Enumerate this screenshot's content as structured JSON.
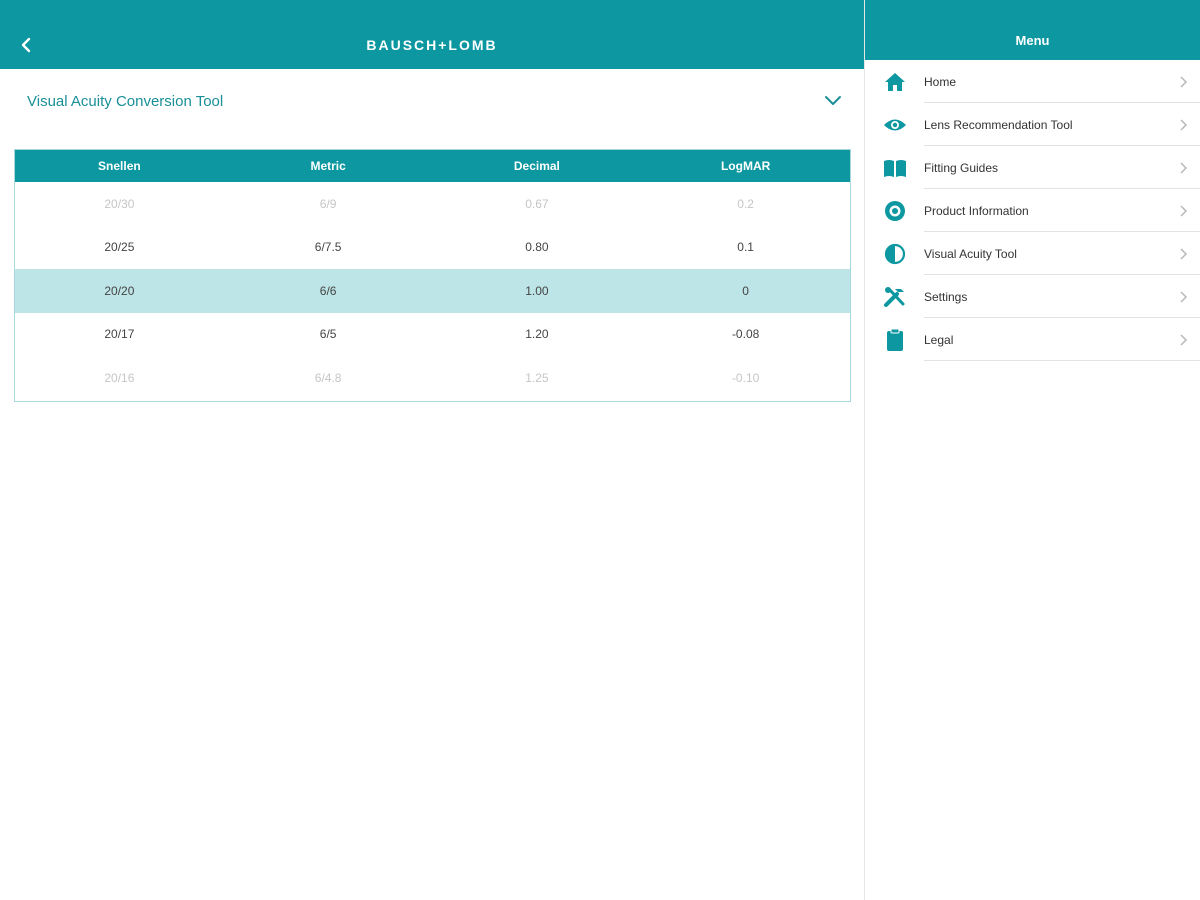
{
  "header": {
    "brand": "BAUSCH+LOMB",
    "back_icon": "chevron-left-icon"
  },
  "tool": {
    "title": "Visual Acuity Conversion Tool",
    "toggle_icon": "chevron-down-icon"
  },
  "table": {
    "columns": [
      "Snellen",
      "Metric",
      "Decimal",
      "LogMAR"
    ],
    "rows": [
      {
        "state": "faded",
        "cells": [
          "20/30",
          "6/9",
          "0.67",
          "0.2"
        ]
      },
      {
        "state": "normal",
        "cells": [
          "20/25",
          "6/7.5",
          "0.80",
          "0.1"
        ]
      },
      {
        "state": "selected",
        "cells": [
          "20/20",
          "6/6",
          "1.00",
          "0"
        ]
      },
      {
        "state": "normal",
        "cells": [
          "20/17",
          "6/5",
          "1.20",
          "-0.08"
        ]
      },
      {
        "state": "faded",
        "cells": [
          "20/16",
          "6/4.8",
          "1.25",
          "-0.10"
        ]
      }
    ]
  },
  "menu": {
    "title": "Menu",
    "items": [
      {
        "label": "Home",
        "icon": "home-icon"
      },
      {
        "label": "Lens Recommendation Tool",
        "icon": "eye-icon"
      },
      {
        "label": "Fitting Guides",
        "icon": "book-icon"
      },
      {
        "label": "Product Information",
        "icon": "product-icon"
      },
      {
        "label": "Visual Acuity Tool",
        "icon": "contrast-icon"
      },
      {
        "label": "Settings",
        "icon": "tools-icon"
      },
      {
        "label": "Legal",
        "icon": "clipboard-icon"
      }
    ]
  },
  "colors": {
    "teal": "#0c97a1",
    "selected_row": "#bde4e7",
    "title_text": "#1a8f98"
  }
}
